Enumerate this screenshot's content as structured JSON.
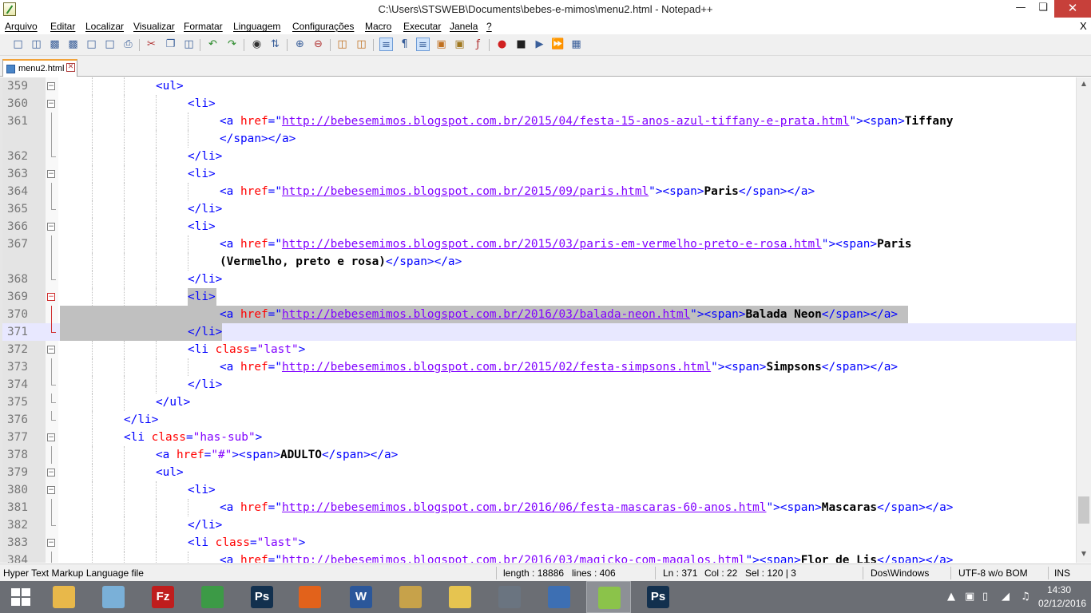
{
  "window": {
    "title": "C:\\Users\\STSWEB\\Documents\\bebes-e-mimos\\menu2.html - Notepad++",
    "min_glyph": "—",
    "max_glyph": "❏",
    "close_glyph": "✕"
  },
  "menu": {
    "items": [
      "Arquivo",
      "Editar",
      "Localizar",
      "Visualizar",
      "Formatar",
      "Linguagem",
      "Configurações",
      "Macro",
      "Executar",
      "Janela",
      "?"
    ],
    "doc_close": "X"
  },
  "toolbar": {
    "icons": [
      "new-file-icon",
      "open-file-icon",
      "save-icon",
      "save-all-icon",
      "close-icon",
      "close-all-icon",
      "print-icon",
      "cut-icon",
      "copy-icon",
      "paste-icon",
      "undo-icon",
      "redo-icon",
      "find-icon",
      "replace-icon",
      "zoom-in-icon",
      "zoom-out-icon",
      "sync-vertical-icon",
      "sync-horizontal-icon",
      "word-wrap-icon",
      "show-all-chars-icon",
      "indent-guide-icon",
      "user-lang-icon",
      "doc-map-icon",
      "function-list-icon",
      "folder-workspace-icon",
      "record-macro-icon",
      "stop-record-icon",
      "play-macro-icon",
      "run-macro-multiple-icon",
      "save-macro-icon"
    ]
  },
  "tabs": [
    {
      "label": "menu2.html",
      "active": true
    }
  ],
  "editor": {
    "current_line": 371,
    "lines": [
      {
        "num": "359",
        "indent": 3,
        "fold": "minus",
        "tokens": [
          [
            "tag",
            "<ul>"
          ]
        ]
      },
      {
        "num": "360",
        "indent": 4,
        "fold": "minus",
        "tokens": [
          [
            "tag",
            "<li>"
          ]
        ]
      },
      {
        "num": "361",
        "indent": 5,
        "fold": "line",
        "tokens": [
          [
            "tag",
            "<a "
          ],
          [
            "attr",
            "href"
          ],
          [
            "tag",
            "=\""
          ],
          [
            "url",
            "http://bebesemimos.blogspot.com.br/2015/04/festa-15-anos-azul-tiffany-e-prata.html"
          ],
          [
            "tag",
            "\"><span>"
          ],
          [
            "txt",
            "Tiffany"
          ]
        ]
      },
      {
        "num": "",
        "indent": 5,
        "fold": "line",
        "tokens": [
          [
            "tag",
            "</span></a>"
          ]
        ]
      },
      {
        "num": "362",
        "indent": 4,
        "fold": "end",
        "tokens": [
          [
            "tag",
            "</li>"
          ]
        ]
      },
      {
        "num": "363",
        "indent": 4,
        "fold": "minus",
        "tokens": [
          [
            "tag",
            "<li>"
          ]
        ]
      },
      {
        "num": "364",
        "indent": 5,
        "fold": "line",
        "tokens": [
          [
            "tag",
            "<a "
          ],
          [
            "attr",
            "href"
          ],
          [
            "tag",
            "=\""
          ],
          [
            "url",
            "http://bebesemimos.blogspot.com.br/2015/09/paris.html"
          ],
          [
            "tag",
            "\"><span>"
          ],
          [
            "txt",
            "Paris"
          ],
          [
            "tag",
            "</span></a>"
          ]
        ]
      },
      {
        "num": "365",
        "indent": 4,
        "fold": "end",
        "tokens": [
          [
            "tag",
            "</li>"
          ]
        ]
      },
      {
        "num": "366",
        "indent": 4,
        "fold": "minus",
        "tokens": [
          [
            "tag",
            "<li>"
          ]
        ]
      },
      {
        "num": "367",
        "indent": 5,
        "fold": "line",
        "tokens": [
          [
            "tag",
            "<a "
          ],
          [
            "attr",
            "href"
          ],
          [
            "tag",
            "=\""
          ],
          [
            "url",
            "http://bebesemimos.blogspot.com.br/2015/03/paris-em-vermelho-preto-e-rosa.html"
          ],
          [
            "tag",
            "\"><span>"
          ],
          [
            "txt",
            "Paris"
          ]
        ]
      },
      {
        "num": "",
        "indent": 5,
        "fold": "line",
        "tokens": [
          [
            "txt",
            "(Vermelho, preto e rosa)"
          ],
          [
            "tag",
            "</span></a>"
          ]
        ]
      },
      {
        "num": "368",
        "indent": 4,
        "fold": "end",
        "tokens": [
          [
            "tag",
            "</li>"
          ]
        ]
      },
      {
        "num": "369",
        "indent": 4,
        "fold": "minus-red",
        "selected": true,
        "tokens": [
          [
            "tag",
            "<li>"
          ]
        ]
      },
      {
        "num": "370",
        "indent": 5,
        "fold": "line-red",
        "selected": true,
        "tokens": [
          [
            "tag",
            "<a "
          ],
          [
            "attr",
            "href"
          ],
          [
            "tag",
            "=\""
          ],
          [
            "url",
            "http://bebesemimos.blogspot.com.br/2016/03/balada-neon.html"
          ],
          [
            "tag",
            "\"><span>"
          ],
          [
            "txt",
            "Balada Neon"
          ],
          [
            "tag",
            "</span></a>"
          ]
        ]
      },
      {
        "num": "371",
        "indent": 4,
        "fold": "end-red",
        "selected": true,
        "current": true,
        "tokens": [
          [
            "tag",
            "</li>"
          ]
        ]
      },
      {
        "num": "372",
        "indent": 4,
        "fold": "minus",
        "tokens": [
          [
            "tag",
            "<li "
          ],
          [
            "attr",
            "class"
          ],
          [
            "tag",
            "="
          ],
          [
            "val",
            "\"last\""
          ],
          [
            "tag",
            ">"
          ]
        ]
      },
      {
        "num": "373",
        "indent": 5,
        "fold": "line",
        "tokens": [
          [
            "tag",
            "<a "
          ],
          [
            "attr",
            "href"
          ],
          [
            "tag",
            "=\""
          ],
          [
            "url",
            "http://bebesemimos.blogspot.com.br/2015/02/festa-simpsons.html"
          ],
          [
            "tag",
            "\"><span>"
          ],
          [
            "txt",
            "Simpsons"
          ],
          [
            "tag",
            "</span></a>"
          ]
        ]
      },
      {
        "num": "374",
        "indent": 4,
        "fold": "end",
        "tokens": [
          [
            "tag",
            "</li>"
          ]
        ]
      },
      {
        "num": "375",
        "indent": 3,
        "fold": "end",
        "tokens": [
          [
            "tag",
            "</ul>"
          ]
        ]
      },
      {
        "num": "376",
        "indent": 2,
        "fold": "end",
        "tokens": [
          [
            "tag",
            "</li>"
          ]
        ]
      },
      {
        "num": "377",
        "indent": 2,
        "fold": "minus",
        "tokens": [
          [
            "tag",
            "<li "
          ],
          [
            "attr",
            "class"
          ],
          [
            "tag",
            "="
          ],
          [
            "val",
            "\"has-sub\""
          ],
          [
            "tag",
            ">"
          ]
        ]
      },
      {
        "num": "378",
        "indent": 3,
        "fold": "line",
        "tokens": [
          [
            "tag",
            "<a "
          ],
          [
            "attr",
            "href"
          ],
          [
            "tag",
            "="
          ],
          [
            "val",
            "\"#\""
          ],
          [
            "tag",
            "><span>"
          ],
          [
            "txt",
            "ADULTO"
          ],
          [
            "tag",
            "</span></a>"
          ]
        ]
      },
      {
        "num": "379",
        "indent": 3,
        "fold": "minus",
        "tokens": [
          [
            "tag",
            "<ul>"
          ]
        ]
      },
      {
        "num": "380",
        "indent": 4,
        "fold": "minus",
        "tokens": [
          [
            "tag",
            "<li>"
          ]
        ]
      },
      {
        "num": "381",
        "indent": 5,
        "fold": "line",
        "tokens": [
          [
            "tag",
            "<a "
          ],
          [
            "attr",
            "href"
          ],
          [
            "tag",
            "=\""
          ],
          [
            "url",
            "http://bebesemimos.blogspot.com.br/2016/06/festa-mascaras-60-anos.html"
          ],
          [
            "tag",
            "\"><span>"
          ],
          [
            "txt",
            "Mascaras"
          ],
          [
            "tag",
            "</span></a>"
          ]
        ]
      },
      {
        "num": "382",
        "indent": 4,
        "fold": "end",
        "tokens": [
          [
            "tag",
            "</li>"
          ]
        ]
      },
      {
        "num": "383",
        "indent": 4,
        "fold": "minus",
        "tokens": [
          [
            "tag",
            "<li "
          ],
          [
            "attr",
            "class"
          ],
          [
            "tag",
            "="
          ],
          [
            "val",
            "\"last\""
          ],
          [
            "tag",
            ">"
          ]
        ]
      },
      {
        "num": "384",
        "indent": 5,
        "fold": "line",
        "tokens": [
          [
            "tag",
            "<a "
          ],
          [
            "attr",
            "href"
          ],
          [
            "tag",
            "=\""
          ],
          [
            "url",
            "http://bebesemimos.blogspot.com.br/2016/03/magicko-com-magalos.html"
          ],
          [
            "tag",
            "\"><span>"
          ],
          [
            "txt",
            "Flor de Lis"
          ],
          [
            "tag",
            "</span></a>"
          ]
        ]
      }
    ]
  },
  "status": {
    "language": "Hyper Text Markup Language file",
    "length": "length : 18886",
    "lines": "lines : 406",
    "ln": "Ln : 371",
    "col": "Col : 22",
    "sel": "Sel : 120 | 3",
    "eol": "Dos\\Windows",
    "encoding": "UTF-8 w/o BOM",
    "mode": "INS"
  },
  "taskbar": {
    "apps": [
      {
        "name": "file-explorer",
        "glyph": "",
        "color": "#e8b84a"
      },
      {
        "name": "notepad-app",
        "glyph": "",
        "color": "#7ab0d8"
      },
      {
        "name": "filezilla",
        "glyph": "Fz",
        "color": "#bf1d1d"
      },
      {
        "name": "chrome",
        "glyph": "",
        "color": "#3c9a46"
      },
      {
        "name": "photoshop",
        "glyph": "Ps",
        "color": "#12304e"
      },
      {
        "name": "firefox",
        "glyph": "",
        "color": "#e2621b"
      },
      {
        "name": "word",
        "glyph": "W",
        "color": "#2b579a"
      },
      {
        "name": "paint",
        "glyph": "",
        "color": "#c7a24a"
      },
      {
        "name": "mail",
        "glyph": "",
        "color": "#e6c450"
      },
      {
        "name": "calculator",
        "glyph": "",
        "color": "#6a7480"
      },
      {
        "name": "scanner",
        "glyph": "",
        "color": "#3d6fb3"
      },
      {
        "name": "notepad-plus-plus",
        "glyph": "",
        "color": "#8bc34a",
        "active": true
      },
      {
        "name": "photoshop-2",
        "glyph": "Ps",
        "color": "#12304e"
      }
    ],
    "clock_time": "14:30",
    "clock_date": "02/12/2016"
  }
}
